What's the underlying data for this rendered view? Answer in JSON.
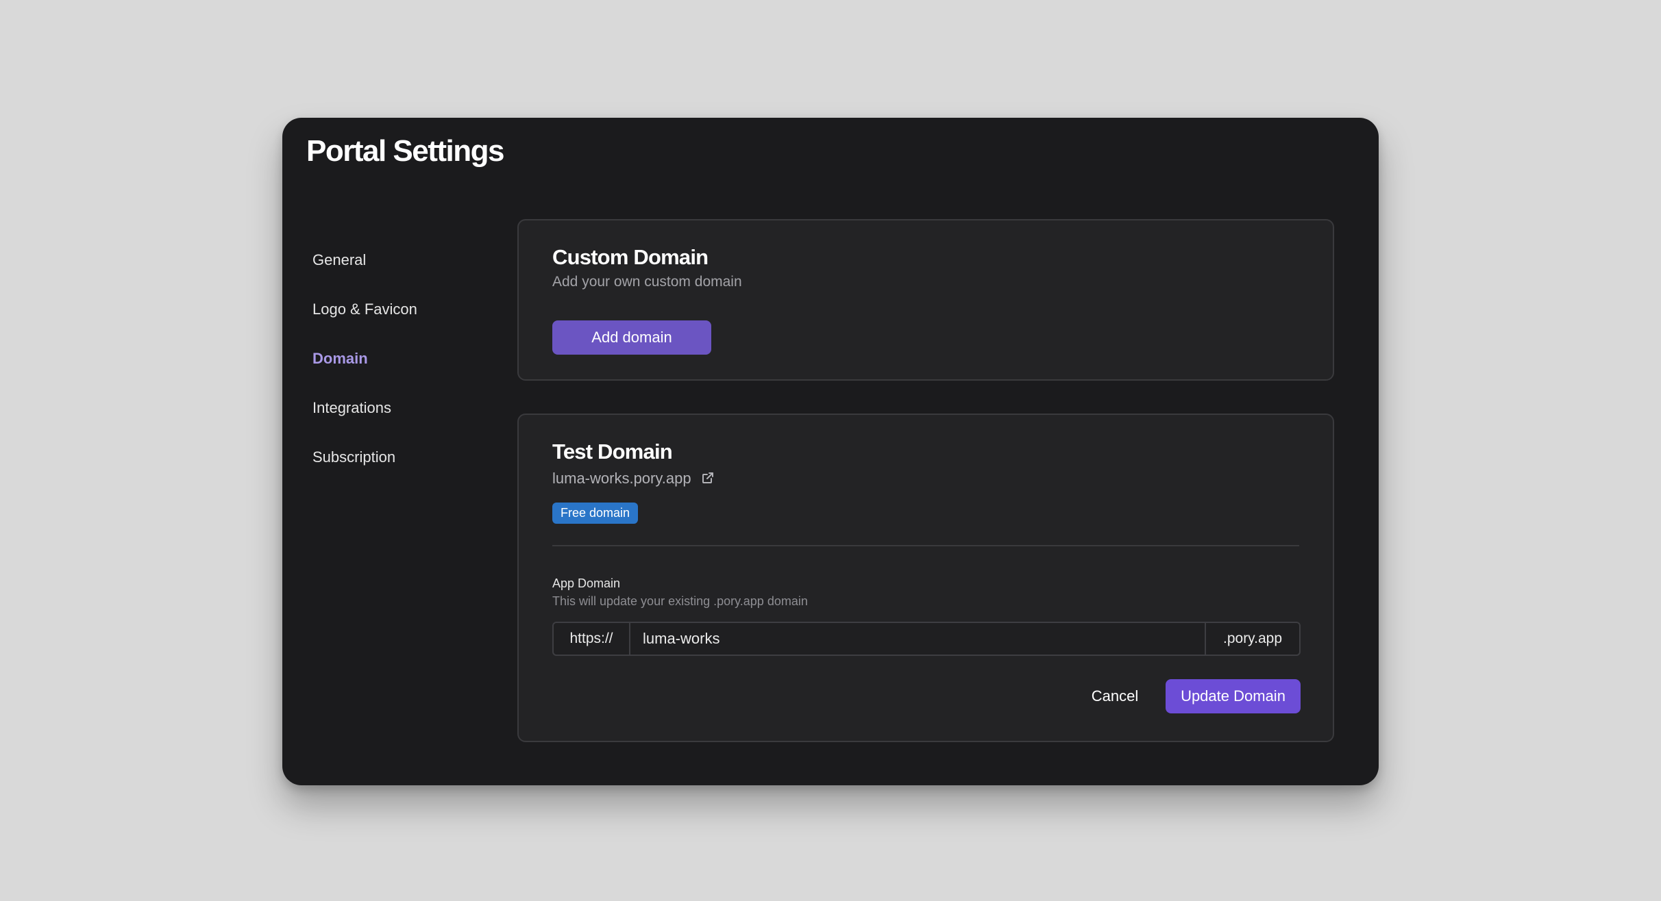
{
  "page": {
    "title": "Portal Settings"
  },
  "sidebar": {
    "items": [
      {
        "label": "General",
        "active": false
      },
      {
        "label": "Logo & Favicon",
        "active": false
      },
      {
        "label": "Domain",
        "active": true
      },
      {
        "label": "Integrations",
        "active": false
      },
      {
        "label": "Subscription",
        "active": false
      }
    ]
  },
  "custom_domain": {
    "title": "Custom Domain",
    "subtitle": "Add your own custom domain",
    "add_button_label": "Add domain"
  },
  "test_domain": {
    "title": "Test Domain",
    "domain_link": "luma-works.pory.app",
    "link_icon": "external-link-icon",
    "badge": "Free domain",
    "field_label": "App Domain",
    "field_help": "This will update your existing .pory.app domain",
    "url_prefix": "https://",
    "url_value": "luma-works",
    "url_suffix": ".pory.app",
    "cancel_label": "Cancel",
    "update_label": "Update Domain"
  },
  "colors": {
    "background": "#d9d9d9",
    "window": "#1b1b1d",
    "card": "#232325",
    "accent": "#6c4dd6",
    "active_nav": "#a999e6",
    "badge": "#2a75c8"
  }
}
